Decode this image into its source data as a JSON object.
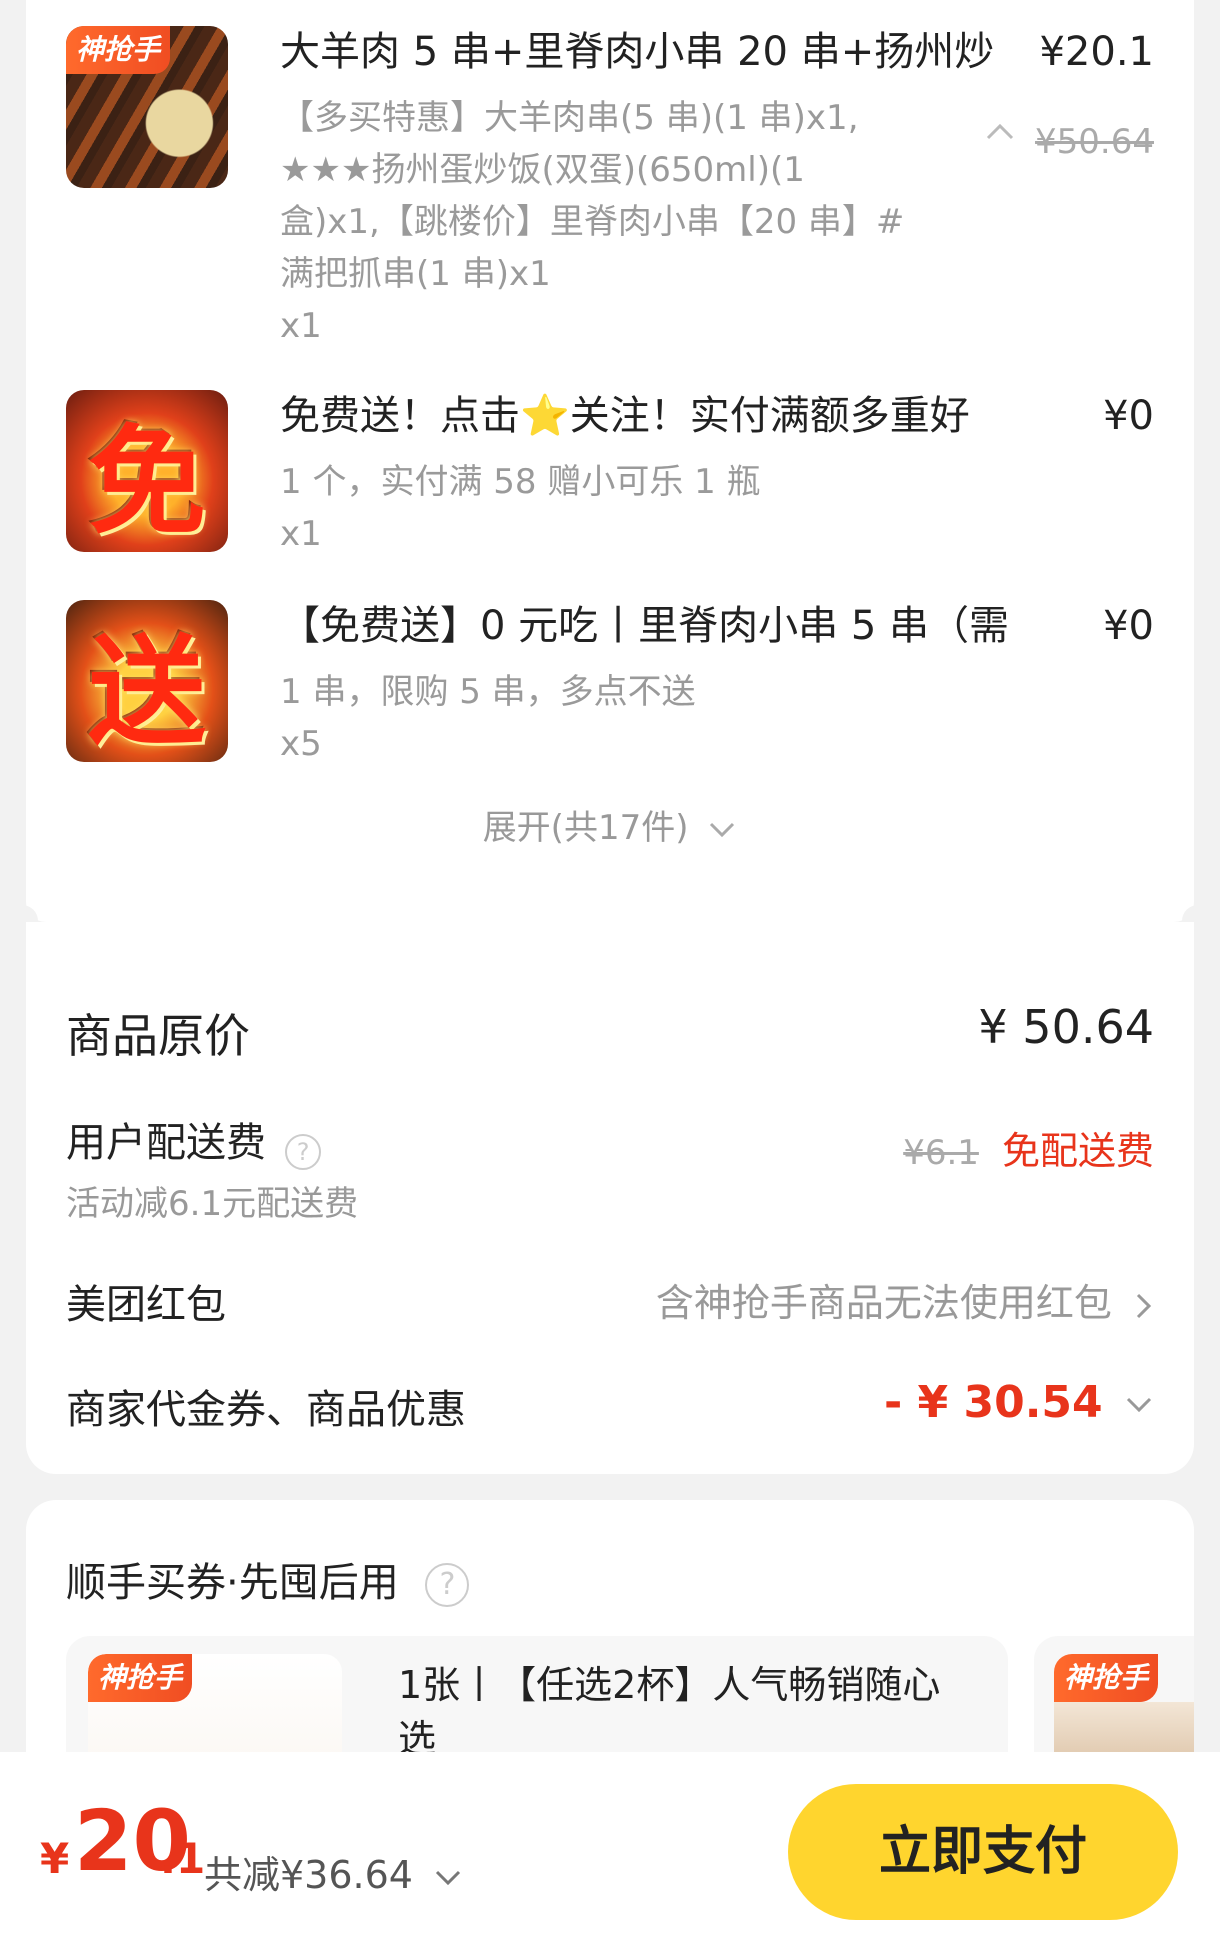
{
  "items": [
    {
      "badge": "神抢手",
      "title": "大羊肉 5 串+里脊肉小串 20 串+扬州炒",
      "price": "¥20.1",
      "original_price": "¥50.64",
      "desc_lines": [
        "【多买特惠】大羊肉串(5 串)(1 串)x1,",
        "★★★扬州蛋炒饭(双蛋)(650ml)(1",
        "盒)x1,【跳楼价】里脊肉小串【20 串】#",
        "满把抓串(1 串)x1"
      ],
      "qty": "x1"
    },
    {
      "glyph": "免",
      "title": "免费送！点击⭐关注！实付满额多重好",
      "price": "¥0",
      "desc_lines": [
        "1 个，实付满 58 赠小可乐 1 瓶"
      ],
      "qty": "x1"
    },
    {
      "glyph": "送",
      "title": "【免费送】0 元吃丨里脊肉小串 5 串（需",
      "price": "¥0",
      "desc_lines": [
        "1 串，限购 5 串，多点不送"
      ],
      "qty": "x5"
    }
  ],
  "expand_label": "展开(共17件)",
  "summary": {
    "original_label": "商品原价",
    "original_value": "¥ 50.64",
    "delivery_label": "用户配送费",
    "delivery_help": "?",
    "delivery_sub": "活动减6.1元配送费",
    "delivery_strike": "¥6.1",
    "delivery_value": "免配送费",
    "redpacket_label": "美团红包",
    "redpacket_value": "含神抢手商品无法使用红包",
    "coupon_label": "商家代金券、商品优惠",
    "coupon_value": "- ¥ 30.54"
  },
  "buy_section": {
    "title": "顺手买券·先囤后用",
    "help": "?",
    "tile_badge": "神抢手",
    "tile_text_line1": "1张丨【任选2杯】人气畅销随心",
    "tile_text_line2": "选",
    "tile2_badge": "神抢手"
  },
  "bottom": {
    "currency": "¥",
    "total_int": "20",
    "total_dec": ".1",
    "saved": "共减¥36.64",
    "pay_label": "立即支付"
  },
  "colors": {
    "accent_red": "#e8341b",
    "pay_yellow": "#ffd52e"
  }
}
